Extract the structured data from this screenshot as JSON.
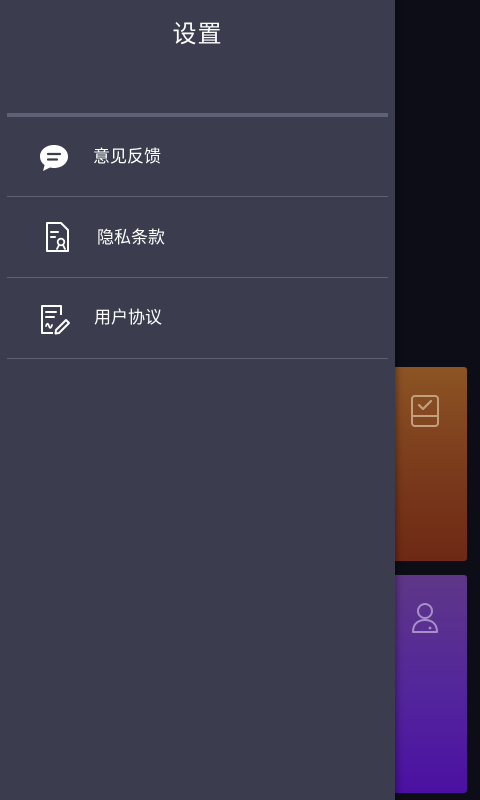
{
  "drawer": {
    "title": "设置",
    "items": [
      {
        "label": "意见反馈",
        "icon": "chat-bubble-icon"
      },
      {
        "label": "隐私条款",
        "icon": "privacy-document-icon"
      },
      {
        "label": "用户协议",
        "icon": "agreement-document-icon"
      }
    ]
  },
  "background": {
    "cards": [
      {
        "icon": "checklist-icon",
        "color": "#7a3a1c"
      },
      {
        "icon": "user-icon",
        "color": "#53259c"
      }
    ]
  },
  "colors": {
    "drawer_bg": "#3b3d4e",
    "screen_bg": "#0d0d18",
    "divider": "#5e6074",
    "text": "#ffffff"
  }
}
